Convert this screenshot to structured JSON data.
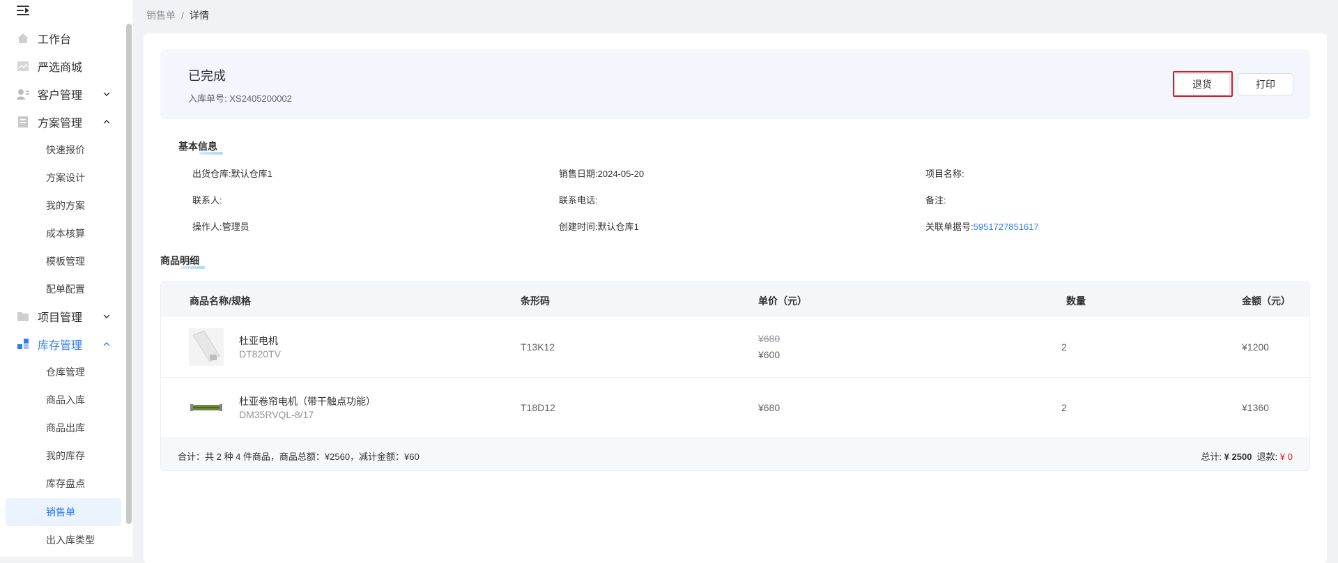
{
  "sidebar": {
    "items": [
      {
        "label": "工作台",
        "icon": "home-icon"
      },
      {
        "label": "严选商城",
        "icon": "image-icon"
      },
      {
        "label": "客户管理",
        "icon": "user-icon",
        "expanded": false
      },
      {
        "label": "方案管理",
        "icon": "document-icon",
        "expanded": true,
        "children": [
          "快速报价",
          "方案设计",
          "我的方案",
          "成本核算",
          "模板管理",
          "配单配置"
        ]
      },
      {
        "label": "项目管理",
        "icon": "folder-icon",
        "expanded": false
      },
      {
        "label": "库存管理",
        "icon": "grid-icon",
        "expanded": true,
        "active": true,
        "children": [
          "仓库管理",
          "商品入库",
          "商品出库",
          "我的库存",
          "库存盘点",
          "销售单",
          "出入库类型"
        ]
      }
    ],
    "active_child": "销售单"
  },
  "breadcrumb": {
    "parent": "销售单",
    "separator": "/",
    "current": "详情"
  },
  "status": {
    "title": "已完成",
    "order_no_label": "入库单号:",
    "order_no": "XS2405200002"
  },
  "actions": {
    "return_label": "退货",
    "print_label": "打印"
  },
  "basic_info": {
    "title": "基本信息",
    "fields": [
      {
        "label": "出货仓库:",
        "value": "默认仓库1"
      },
      {
        "label": "销售日期:",
        "value": "2024-05-20"
      },
      {
        "label": "项目名称:",
        "value": ""
      },
      {
        "label": "联系人:",
        "value": ""
      },
      {
        "label": "联系电话:",
        "value": ""
      },
      {
        "label": "备注:",
        "value": ""
      },
      {
        "label": "操作人:",
        "value": "管理员"
      },
      {
        "label": "创建时间:",
        "value": "默认仓库1"
      },
      {
        "label": "关联单据号:",
        "value": "5951727851617"
      }
    ]
  },
  "products": {
    "title": "商品明细",
    "columns": [
      "商品名称/规格",
      "条形码",
      "单价（元）",
      "数量",
      "金额（元）"
    ],
    "rows": [
      {
        "name": "杜亚电机",
        "spec": "DT820TV",
        "barcode": "T13K12",
        "original_price": "¥680",
        "price": "¥600",
        "qty": "2",
        "amount": "¥1200"
      },
      {
        "name": "杜亚卷帘电机（带干触点功能）",
        "spec": "DM35RVQL-8/17",
        "barcode": "T18D12",
        "original_price": "",
        "price": "¥680",
        "qty": "2",
        "amount": "¥1360"
      }
    ],
    "summary": "合计：共 2 种 4 件商品，商品总额：¥2560，减计金额：¥60",
    "total_label": "总计:",
    "total_value": "¥ 2500",
    "refund_label": "退款:",
    "refund_value": "¥ 0"
  },
  "colors": {
    "accent": "#2f7cf6",
    "highlight": "#e0191e"
  }
}
